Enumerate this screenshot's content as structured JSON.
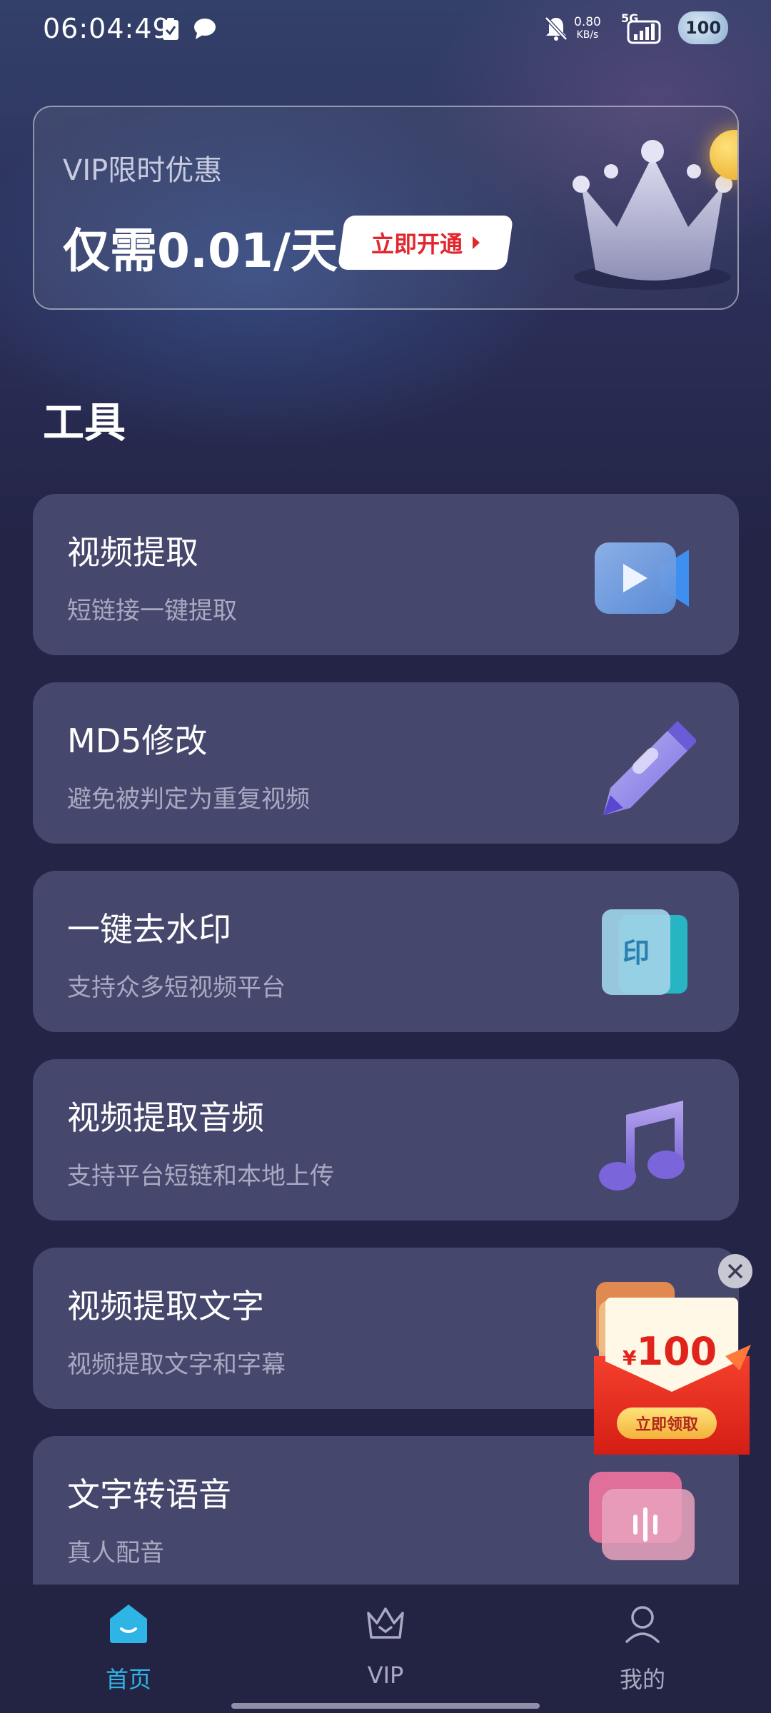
{
  "status_bar": {
    "time": "06:04:49",
    "net_speed_value": "0.80",
    "net_speed_unit": "KB/s",
    "network": "5G",
    "battery": "100"
  },
  "vip_banner": {
    "tag": "VIP限时优惠",
    "price": "仅需0.01/天",
    "button_label": "立即开通"
  },
  "section_title": "工具",
  "tools": [
    {
      "title": "视频提取",
      "subtitle": "短链接一键提取",
      "icon": "video-camera-icon"
    },
    {
      "title": "MD5修改",
      "subtitle": "避免被判定为重复视频",
      "icon": "pen-icon"
    },
    {
      "title": "一键去水印",
      "subtitle": "支持众多短视频平台",
      "icon": "stamp-icon",
      "icon_text": "印"
    },
    {
      "title": "视频提取音频",
      "subtitle": "支持平台短链和本地上传",
      "icon": "music-note-icon"
    },
    {
      "title": "视频提取文字",
      "subtitle": "视频提取文字和字幕",
      "icon": "text-extract-icon"
    },
    {
      "title": "文字转语音",
      "subtitle": "真人配音",
      "icon": "voice-wave-icon"
    }
  ],
  "promo": {
    "currency": "¥",
    "amount": "100",
    "button_label": "立即领取"
  },
  "bottom_nav": [
    {
      "label": "首页",
      "active": true
    },
    {
      "label": "VIP",
      "active": false
    },
    {
      "label": "我的",
      "active": false
    }
  ],
  "colors": {
    "background": "#232446",
    "card": "#46476c",
    "accent_active": "#2fb4e6",
    "vip_red": "#e2262e"
  }
}
